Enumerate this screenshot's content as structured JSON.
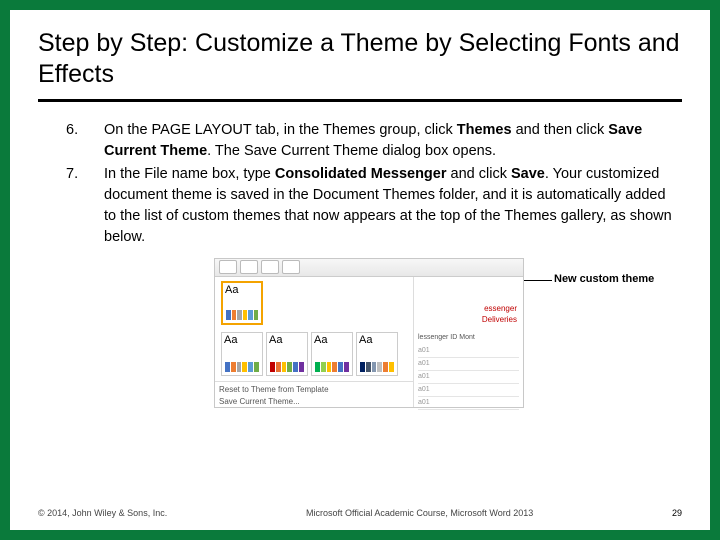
{
  "title": "Step by Step: Customize a Theme by Selecting Fonts and Effects",
  "steps": [
    {
      "num": "6.",
      "html": "On the PAGE LAYOUT tab, in the Themes group, click <b>Themes</b> and then click <b>Save Current Theme</b>. The Save Current Theme dialog box opens."
    },
    {
      "num": "7.",
      "html": "In the File name box, type <b>Consolidated Messenger</b> and click <b>Save</b>. Your customized document theme is saved in the Document Themes folder, and it is automatically added to the list of custom themes that now appears at the top of the Themes gallery, as shown below."
    }
  ],
  "callout": "New custom theme",
  "illus": {
    "memo1": "essenger",
    "memo2": "Deliveries",
    "label": "lessenger ID Mont",
    "rows": [
      "a01",
      "a01",
      "a01",
      "a01",
      "a01"
    ],
    "footer1": "Reset to Theme from Template",
    "footer2": "Save Current Theme..."
  },
  "footer": {
    "left": "© 2014, John Wiley & Sons, Inc.",
    "center": "Microsoft Official Academic Course, Microsoft Word 2013",
    "right": "29"
  }
}
